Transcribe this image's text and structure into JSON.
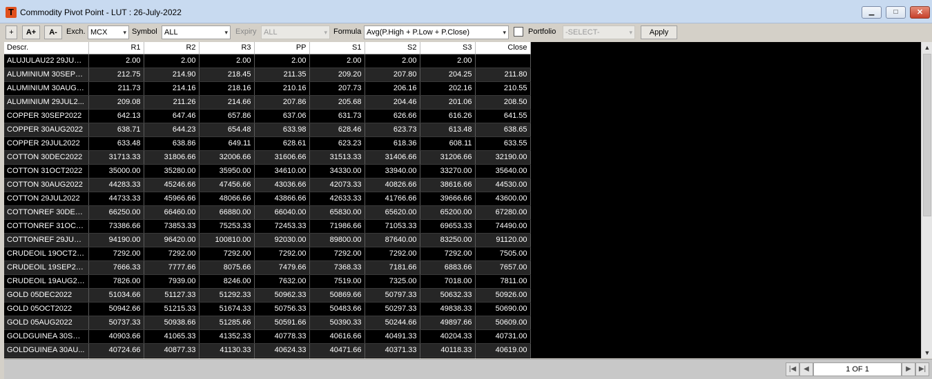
{
  "window": {
    "icon_letter": "T",
    "title": "Commodity Pivot Point - LUT : 26-July-2022",
    "min_glyph": "▁",
    "max_glyph": "□",
    "close_glyph": "✕"
  },
  "toolbar": {
    "add_label": "+",
    "font_increase_label": "A+",
    "font_decrease_label": "A-",
    "exch_label": "Exch.",
    "exch_value": "MCX",
    "symbol_label": "Symbol",
    "symbol_value": "ALL",
    "expiry_label": "Expiry",
    "expiry_value": "ALL",
    "formula_label": "Formula",
    "formula_value": "Avg(P.High + P.Low + P.Close)",
    "portfolio_checked": false,
    "portfolio_label": "Portfolio",
    "portfolio_value": "-SELECT-",
    "apply_label": "Apply",
    "dropdown_arrow": "▾"
  },
  "grid": {
    "columns": [
      "Descr.",
      "R1",
      "R2",
      "R3",
      "PP",
      "S1",
      "S2",
      "S3",
      "Close"
    ],
    "rows": [
      [
        "ALUJULAU22 29JUL2...",
        "2.00",
        "2.00",
        "2.00",
        "2.00",
        "2.00",
        "2.00",
        "2.00",
        ""
      ],
      [
        "ALUMINIUM 30SEP2...",
        "212.75",
        "214.90",
        "218.45",
        "211.35",
        "209.20",
        "207.80",
        "204.25",
        "211.80"
      ],
      [
        "ALUMINIUM 30AUG2...",
        "211.73",
        "214.16",
        "218.16",
        "210.16",
        "207.73",
        "206.16",
        "202.16",
        "210.55"
      ],
      [
        "ALUMINIUM 29JUL2...",
        "209.08",
        "211.26",
        "214.66",
        "207.86",
        "205.68",
        "204.46",
        "201.06",
        "208.50"
      ],
      [
        "COPPER 30SEP2022",
        "642.13",
        "647.46",
        "657.86",
        "637.06",
        "631.73",
        "626.66",
        "616.26",
        "641.55"
      ],
      [
        "COPPER 30AUG2022",
        "638.71",
        "644.23",
        "654.48",
        "633.98",
        "628.46",
        "623.73",
        "613.48",
        "638.65"
      ],
      [
        "COPPER 29JUL2022",
        "633.48",
        "638.86",
        "649.11",
        "628.61",
        "623.23",
        "618.36",
        "608.11",
        "633.55"
      ],
      [
        "COTTON 30DEC2022",
        "31713.33",
        "31806.66",
        "32006.66",
        "31606.66",
        "31513.33",
        "31406.66",
        "31206.66",
        "32190.00"
      ],
      [
        "COTTON 31OCT2022",
        "35000.00",
        "35280.00",
        "35950.00",
        "34610.00",
        "34330.00",
        "33940.00",
        "33270.00",
        "35640.00"
      ],
      [
        "COTTON 30AUG2022",
        "44283.33",
        "45246.66",
        "47456.66",
        "43036.66",
        "42073.33",
        "40826.66",
        "38616.66",
        "44530.00"
      ],
      [
        "COTTON 29JUL2022",
        "44733.33",
        "45966.66",
        "48066.66",
        "43866.66",
        "42633.33",
        "41766.66",
        "39666.66",
        "43600.00"
      ],
      [
        "COTTONREF 30DEC...",
        "66250.00",
        "66460.00",
        "66880.00",
        "66040.00",
        "65830.00",
        "65620.00",
        "65200.00",
        "67280.00"
      ],
      [
        "COTTONREF 31OCT...",
        "73386.66",
        "73853.33",
        "75253.33",
        "72453.33",
        "71986.66",
        "71053.33",
        "69653.33",
        "74490.00"
      ],
      [
        "COTTONREF 29JUL2...",
        "94190.00",
        "96420.00",
        "100810.00",
        "92030.00",
        "89800.00",
        "87640.00",
        "83250.00",
        "91120.00"
      ],
      [
        "CRUDEOIL 19OCT2022",
        "7292.00",
        "7292.00",
        "7292.00",
        "7292.00",
        "7292.00",
        "7292.00",
        "7292.00",
        "7505.00"
      ],
      [
        "CRUDEOIL 19SEP2022",
        "7666.33",
        "7777.66",
        "8075.66",
        "7479.66",
        "7368.33",
        "7181.66",
        "6883.66",
        "7657.00"
      ],
      [
        "CRUDEOIL 19AUG2022",
        "7826.00",
        "7939.00",
        "8246.00",
        "7632.00",
        "7519.00",
        "7325.00",
        "7018.00",
        "7811.00"
      ],
      [
        "GOLD 05DEC2022",
        "51034.66",
        "51127.33",
        "51292.33",
        "50962.33",
        "50869.66",
        "50797.33",
        "50632.33",
        "50926.00"
      ],
      [
        "GOLD 05OCT2022",
        "50942.66",
        "51215.33",
        "51674.33",
        "50756.33",
        "50483.66",
        "50297.33",
        "49838.33",
        "50690.00"
      ],
      [
        "GOLD 05AUG2022",
        "50737.33",
        "50938.66",
        "51285.66",
        "50591.66",
        "50390.33",
        "50244.66",
        "49897.66",
        "50609.00"
      ],
      [
        "GOLDGUINEA 30SEP...",
        "40903.66",
        "41065.33",
        "41352.33",
        "40778.33",
        "40616.66",
        "40491.33",
        "40204.33",
        "40731.00"
      ],
      [
        "GOLDGUINEA 30AU...",
        "40724.66",
        "40877.33",
        "41130.33",
        "40624.33",
        "40471.66",
        "40371.33",
        "40118.33",
        "40619.00"
      ],
      [
        "",
        "",
        "",
        "",
        "",
        "",
        "",
        "",
        ""
      ]
    ]
  },
  "scrollbar": {
    "up_glyph": "▲",
    "down_glyph": "▼"
  },
  "pager": {
    "first_glyph": "|◀",
    "prev_glyph": "◀",
    "page_text": "1 OF 1",
    "next_glyph": "▶",
    "last_glyph": "▶|"
  }
}
